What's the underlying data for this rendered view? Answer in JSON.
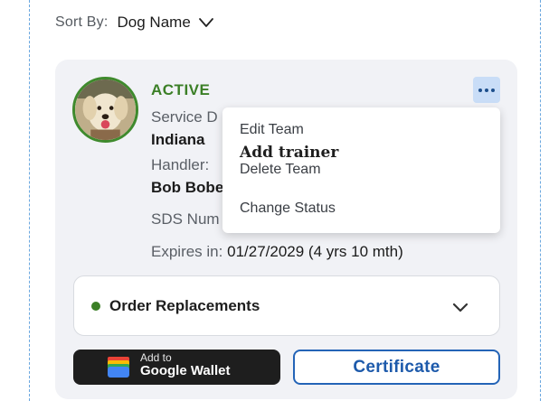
{
  "sort": {
    "label": "Sort By:",
    "value": "Dog Name",
    "chevron_icon": "chevron-down-icon"
  },
  "card": {
    "avatar_icon": "dog-photo",
    "status": "ACTIVE",
    "status_color": "#3b7f26",
    "service_label": "Service D",
    "service_value": "Indiana",
    "handler_label": "Handler:",
    "handler_value": "Bob Bobe",
    "sds_label": "SDS Num",
    "expires_label": "Expires in:",
    "expires_value": "01/27/2029 (4 yrs 10 mth)",
    "more_icon": "ellipsis-icon"
  },
  "menu": {
    "items": [
      {
        "label": "Edit Team"
      },
      {
        "label": "Add trainer"
      },
      {
        "label": "Delete Team"
      },
      {
        "label": "Change Status"
      }
    ]
  },
  "order": {
    "label": "Order Replacements",
    "dot_color": "#3b7f26",
    "chevron_icon": "chevron-down-icon"
  },
  "wallet": {
    "small": "Add to",
    "big": "Google Wallet",
    "icon": "google-wallet-icon"
  },
  "certificate": {
    "label": "Certificate",
    "accent": "#2464b7"
  }
}
